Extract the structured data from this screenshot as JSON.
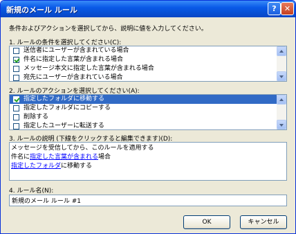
{
  "window": {
    "title": "新規のメール ルール",
    "help_label": "?",
    "close_label": "✕"
  },
  "instructions": "条件およびアクションを選択してから、説明に値を入力してください。",
  "step1": {
    "label": "1. ルールの条件を選択してください(C):",
    "items": [
      {
        "label": "送信者にユーザーが含まれている場合",
        "checked": false
      },
      {
        "label": "件名に指定した言葉が含まれる場合",
        "checked": true
      },
      {
        "label": "メッセージ本文に指定した言葉が含まれる場合",
        "checked": false
      },
      {
        "label": "宛先にユーザーが含まれている場合",
        "checked": false
      }
    ]
  },
  "step2": {
    "label": "2. ルールのアクションを選択してください(A):",
    "items": [
      {
        "label": "指定したフォルダに移動する",
        "checked": true,
        "selected": true
      },
      {
        "label": "指定したフォルダにコピーする",
        "checked": false,
        "selected": false
      },
      {
        "label": "削除する",
        "checked": false,
        "selected": false
      },
      {
        "label": "指定したユーザーに転送する",
        "checked": false,
        "selected": false
      }
    ]
  },
  "step3": {
    "label": "3. ルールの説明 (下線をクリックすると編集できます)(D):",
    "line1": "メッセージを受信してから、このルールを適用する",
    "line2_prefix": "件名に",
    "line2_link": "指定した言葉が含まれる",
    "line2_suffix": "場合",
    "line3_link": "指定したフォルダ",
    "line3_suffix": "に移動する"
  },
  "step4": {
    "label": "4. ルール名(N):",
    "value": "新規のメール ルール #1"
  },
  "buttons": {
    "ok": "OK",
    "cancel": "キャンセル"
  },
  "colors": {
    "title_bar": "#0a5ae8",
    "dialog_bg": "#ece9d8",
    "selection": "#316ac5",
    "link": "#0000ff"
  }
}
